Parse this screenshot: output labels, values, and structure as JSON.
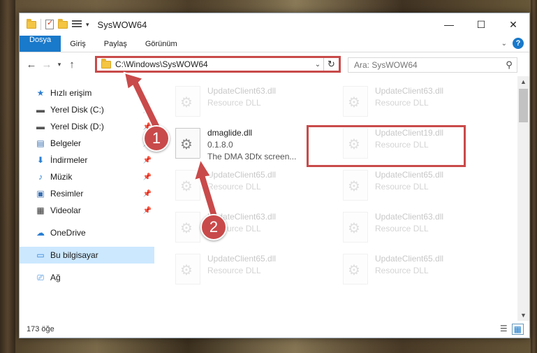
{
  "window": {
    "title": "SysWOW64",
    "controls": {
      "minimize": "—",
      "maximize": "☐",
      "close": "✕"
    }
  },
  "ribbon": {
    "tabs": [
      "Dosya",
      "Giriş",
      "Paylaş",
      "Görünüm"
    ],
    "help_label": "?"
  },
  "address": {
    "path": "C:\\Windows\\SysWOW64",
    "search_placeholder": "Ara: SysWOW64"
  },
  "nav": {
    "items": [
      {
        "label": "Hızlı erişim",
        "icon": "star-icon",
        "pinned": false
      },
      {
        "label": "Yerel Disk (C:)",
        "icon": "drive-icon",
        "pinned": true
      },
      {
        "label": "Yerel Disk (D:)",
        "icon": "drive-icon",
        "pinned": true
      },
      {
        "label": "Belgeler",
        "icon": "documents-icon",
        "pinned": true
      },
      {
        "label": "İndirmeler",
        "icon": "download-icon",
        "pinned": true
      },
      {
        "label": "Müzik",
        "icon": "music-icon",
        "pinned": true
      },
      {
        "label": "Resimler",
        "icon": "pictures-icon",
        "pinned": true
      },
      {
        "label": "Videolar",
        "icon": "video-icon",
        "pinned": true
      },
      {
        "label": "OneDrive",
        "icon": "cloud-icon",
        "pinned": false
      },
      {
        "label": "Bu bilgisayar",
        "icon": "computer-icon",
        "pinned": false,
        "selected": true
      },
      {
        "label": "Ağ",
        "icon": "network-icon",
        "pinned": false
      }
    ]
  },
  "files": {
    "left": [
      {
        "name": "UpdateClient63.dll",
        "sub": "Resource DLL"
      },
      {
        "name": "dmaglide.dll",
        "version": "0.1.8.0",
        "desc": "The DMA 3Dfx screen...",
        "highlighted": true
      },
      {
        "name": "UpdateClient65.dll",
        "sub": "Resource DLL"
      },
      {
        "name": "UpdateClient63.dll",
        "sub": "Resource DLL"
      },
      {
        "name": "UpdateClient65.dll",
        "sub": "Resource DLL"
      }
    ],
    "right": [
      {
        "name": "UpdateClient63.dll",
        "sub": "Resource DLL"
      },
      {
        "name": "UpdateClient19.dll",
        "sub": "Resource DLL"
      },
      {
        "name": "UpdateClient65.dll",
        "sub": "Resource DLL"
      },
      {
        "name": "UpdateClient63.dll",
        "sub": "Resource DLL"
      },
      {
        "name": "UpdateClient65.dll",
        "sub": "Resource DLL"
      }
    ]
  },
  "status": {
    "count_text": "173 öğe"
  },
  "annotations": {
    "step1": "1",
    "step2": "2"
  },
  "colors": {
    "accent": "#1979ca",
    "highlight": "#c94a4a",
    "selected_bg": "#cce8ff"
  }
}
